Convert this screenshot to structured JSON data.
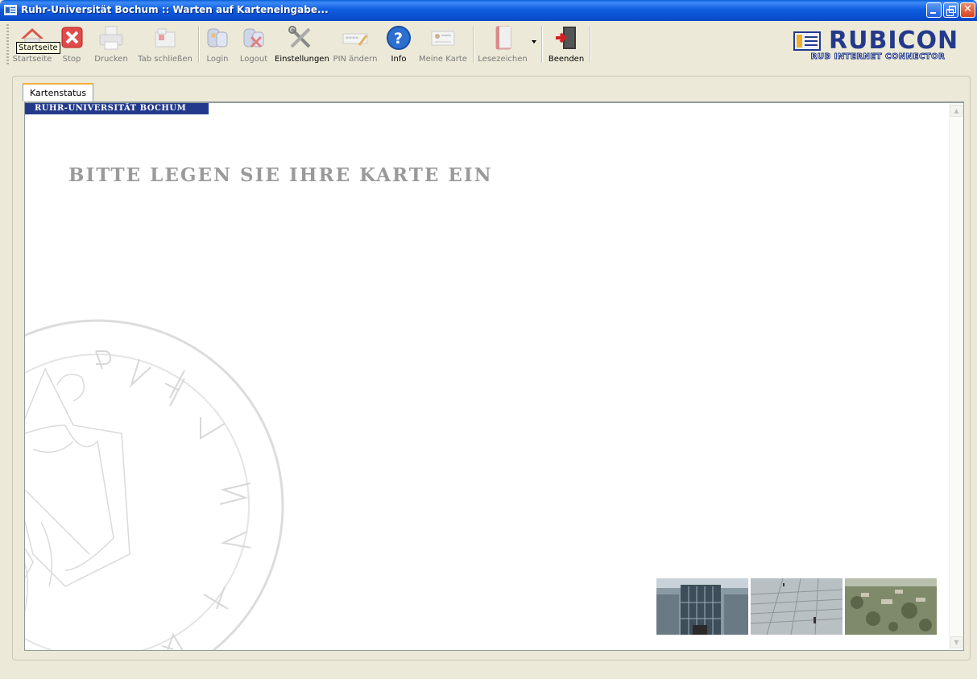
{
  "window": {
    "title": "Ruhr-Universität Bochum :: Warten auf Karteneingabe..."
  },
  "toolbar": {
    "items": [
      {
        "label": "Startseite",
        "icon": "home-icon",
        "enabled": false
      },
      {
        "label": "Stop",
        "icon": "stop-icon",
        "enabled": false
      },
      {
        "label": "Drucken",
        "icon": "printer-icon",
        "enabled": false
      },
      {
        "label": "Tab schließen",
        "icon": "close-tab-icon",
        "enabled": false
      },
      {
        "label": "Login",
        "icon": "login-icon",
        "enabled": false
      },
      {
        "label": "Logout",
        "icon": "logout-icon",
        "enabled": false
      },
      {
        "label": "Einstellungen",
        "icon": "settings-tools-icon",
        "enabled": true
      },
      {
        "label": "PIN ändern",
        "icon": "pin-change-icon",
        "enabled": false
      },
      {
        "label": "Info",
        "icon": "info-icon",
        "enabled": true
      },
      {
        "label": "Meine Karte",
        "icon": "id-card-icon",
        "enabled": false
      },
      {
        "label": "Lesezeichen",
        "icon": "bookmark-book-icon",
        "enabled": false
      },
      {
        "label": "Beenden",
        "icon": "exit-door-icon",
        "enabled": true
      }
    ],
    "tooltip": "Startseite"
  },
  "logo": {
    "word": "RUBICON",
    "tagline": "RUB INTERNET CONNECTOR"
  },
  "tabs": [
    {
      "label": "Kartenstatus",
      "active": true
    }
  ],
  "page": {
    "banner": "RUHR-UNIVERSITÄT BOCHUM",
    "prompt": "BITTE LEGEN SIE IHRE KARTE EIN"
  },
  "colors": {
    "brand_blue": "#233a8c",
    "titlebar_blue": "#0a4fd0",
    "tab_accent": "#f4b03c"
  }
}
